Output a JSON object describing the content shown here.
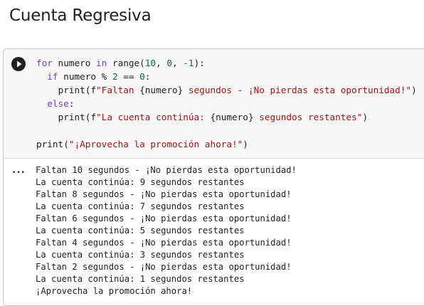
{
  "section": {
    "title": "Cuenta Regresiva"
  },
  "cell": {
    "run_icon": "play-icon",
    "code": {
      "l1": {
        "a": "for",
        "b": " numero ",
        "c": "in",
        "d": " range(",
        "e": "10",
        "f": ", ",
        "g": "0",
        "h": ", ",
        "i": "-1",
        "j": "):"
      },
      "l2": {
        "a": "if",
        "b": " numero % ",
        "c": "2",
        "d": " == ",
        "e": "0",
        "f": ":"
      },
      "l3": {
        "a": "print(f",
        "b": "\"Faltan ",
        "c": "{numero}",
        "d": " segundos - ¡No pierdas esta oportunidad!\"",
        "e": ")"
      },
      "l4": {
        "a": "else",
        "b": ":"
      },
      "l5": {
        "a": "print(f",
        "b": "\"La cuenta continúa: ",
        "c": "{numero}",
        "d": " segundos restantes\"",
        "e": ")"
      },
      "l7": {
        "a": "print(",
        "b": "\"¡Aprovecha la promoción ahora!\"",
        "c": ")"
      }
    },
    "output_menu": "...",
    "output": [
      "Faltan 10 segundos - ¡No pierdas esta oportunidad!",
      "La cuenta continúa: 9 segundos restantes",
      "Faltan 8 segundos - ¡No pierdas esta oportunidad!",
      "La cuenta continúa: 7 segundos restantes",
      "Faltan 6 segundos - ¡No pierdas esta oportunidad!",
      "La cuenta continúa: 5 segundos restantes",
      "Faltan 4 segundos - ¡No pierdas esta oportunidad!",
      "La cuenta continúa: 3 segundos restantes",
      "Faltan 2 segundos - ¡No pierdas esta oportunidad!",
      "La cuenta continúa: 1 segundos restantes",
      "¡Aprovecha la promoción ahora!"
    ]
  }
}
